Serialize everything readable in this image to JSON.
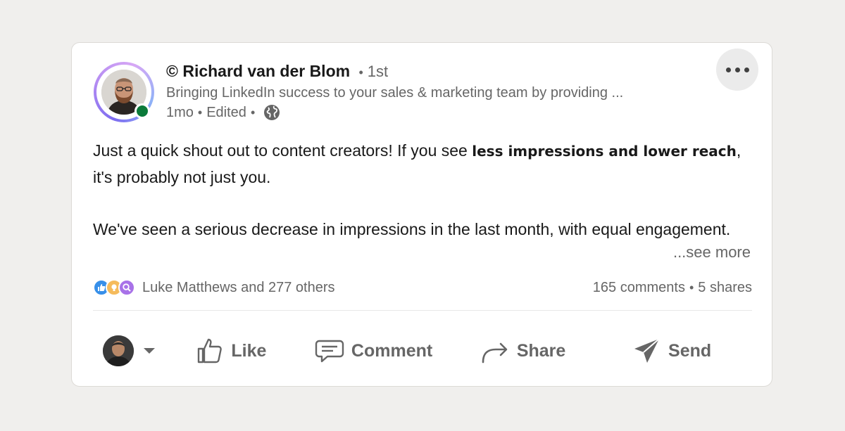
{
  "post": {
    "copyright_mark": "©",
    "author_name": "Richard van der Blom",
    "connection_degree": "1st",
    "headline": "Bringing LinkedIn success to your sales & marketing team by providing ...",
    "age": "1mo",
    "edited": "Edited",
    "visibility_icon": "globe-icon",
    "body_line1_start": "Just a quick shout out to content creators! If you see ",
    "body_bold": "less impressions and lower reach",
    "body_line1_end": ", it's probably not just you.",
    "body_paragraph2": "We've seen a serious decrease in impressions in the last month, with equal engagement.",
    "see_more": "...see more"
  },
  "social": {
    "reactions_text": "Luke Matthews and 277 others",
    "comments": "165 comments",
    "shares": "5 shares",
    "reaction_icons": [
      "like-icon",
      "insightful-icon",
      "curious-icon"
    ]
  },
  "actions": {
    "like": "Like",
    "comment": "Comment",
    "share": "Share",
    "send": "Send"
  },
  "colors": {
    "background": "#f0efed",
    "online": "#0b7a3a",
    "muted_text": "#666666",
    "like_blue": "#378fe9",
    "insightful_gold": "#f5bb5c",
    "curious_purple": "#a872e8"
  }
}
